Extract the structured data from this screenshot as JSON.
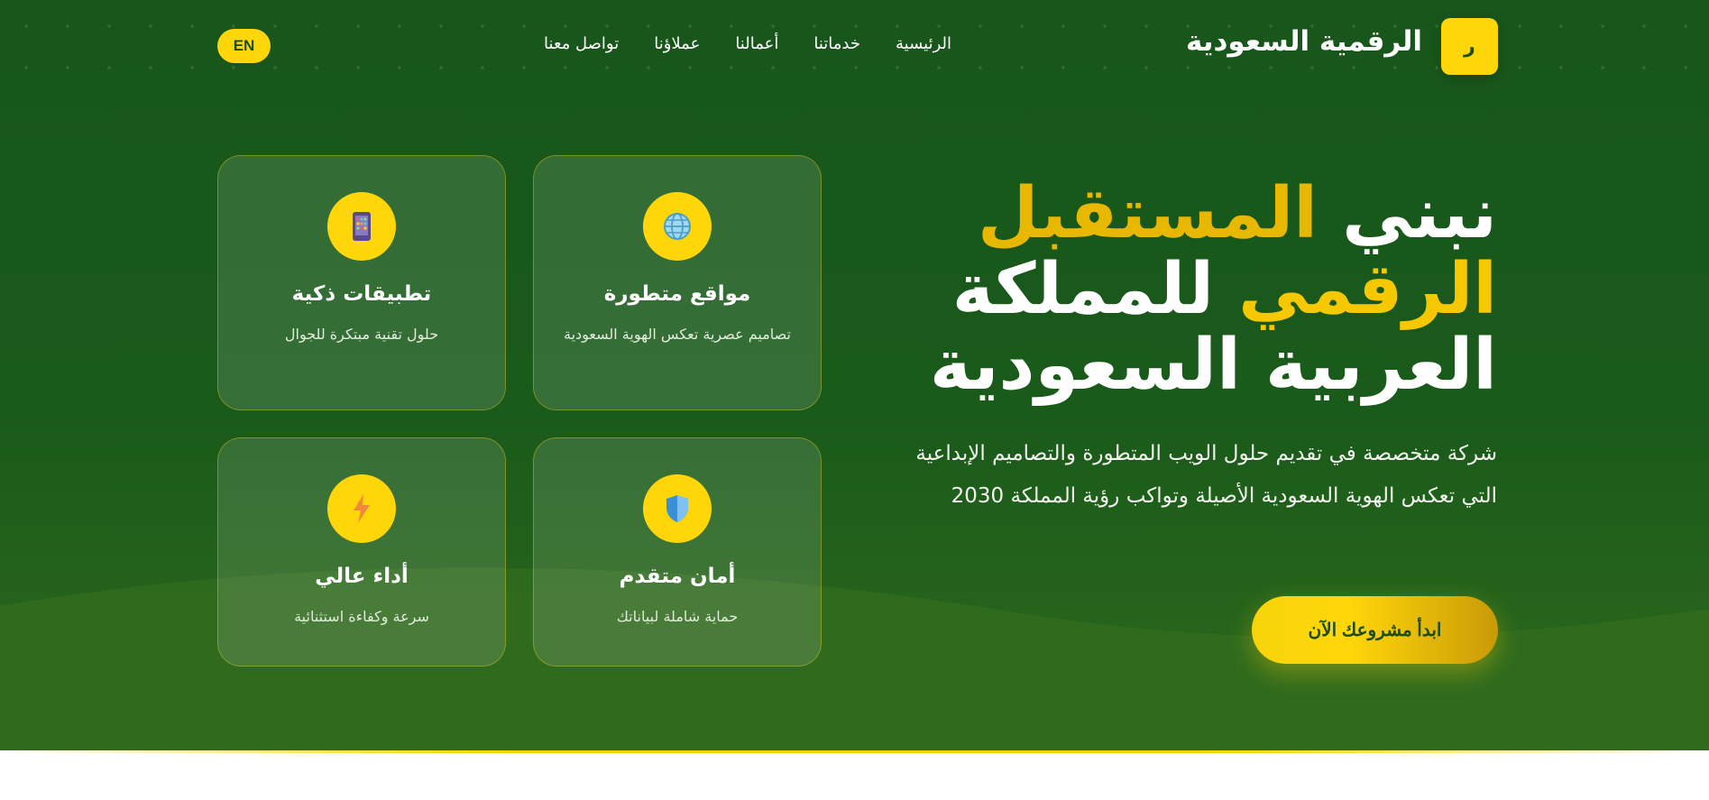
{
  "header": {
    "brand_name": "الرقمية السعودية",
    "logo_letter": "ر",
    "lang_button": "EN",
    "nav": [
      {
        "label": "الرئيسية"
      },
      {
        "label": "خدماتنا"
      },
      {
        "label": "أعمالنا"
      },
      {
        "label": "عملاؤنا"
      },
      {
        "label": "تواصل معنا"
      }
    ]
  },
  "hero": {
    "headline_part1": "نبني ",
    "headline_part2": "المستقبل",
    "headline_part3": "الرقمي",
    "headline_part4": " للمملكة",
    "headline_part5": "العربية السعودية",
    "description": "شركة متخصصة في تقديم حلول الويب المتطورة والتصاميم الإبداعية التي تعكس الهوية السعودية الأصيلة وتواكب رؤية المملكة 2030",
    "cta_label": "ابدأ مشروعك الآن"
  },
  "features": [
    {
      "title": "مواقع متطورة",
      "subtitle": "تصاميم عصرية تعكس الهوية السعودية",
      "icon": "globe-icon"
    },
    {
      "title": "تطبيقات ذكية",
      "subtitle": "حلول تقنية مبتكرة للجوال",
      "icon": "mobile-phone-icon"
    },
    {
      "title": "أمان متقدم",
      "subtitle": "حماية شاملة لبياناتك",
      "icon": "shield-icon"
    },
    {
      "title": "أداء عالي",
      "subtitle": "سرعة وكفاءة استثنائية",
      "icon": "lightning-icon"
    }
  ],
  "colors": {
    "primary_green": "#18561b",
    "accent_yellow": "#ffd60a",
    "highlight_gold": "#e8b800"
  }
}
